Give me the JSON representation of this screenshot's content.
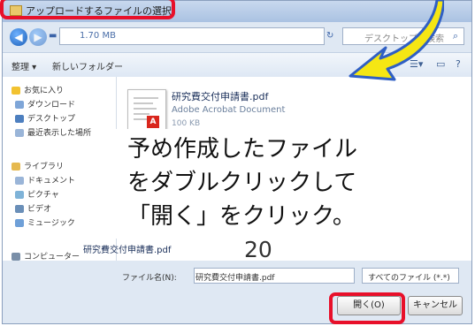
{
  "dialog": {
    "title": "アップロードするファイルの選択",
    "address": "1.70 MB",
    "search_placeholder": "デスクトップの検索"
  },
  "toolbar": {
    "organize": "整理 ▾",
    "new_folder": "新しいフォルダー"
  },
  "nav": {
    "items": [
      {
        "label": "お気に入り",
        "color": "#f2c230"
      },
      {
        "label": "ダウンロード",
        "color": "#7fa6d8"
      },
      {
        "label": "デスクトップ",
        "color": "#4d7fbf"
      },
      {
        "label": "最近表示した場所",
        "color": "#9ab5d8"
      },
      {
        "label": "ライブラリ",
        "color": "#e6b94f"
      },
      {
        "label": "ドキュメント",
        "color": "#9ab5d8"
      },
      {
        "label": "ピクチャ",
        "color": "#7fb3d8"
      },
      {
        "label": "ビデオ",
        "color": "#6a8fb8"
      },
      {
        "label": "ミュージック",
        "color": "#6fa0d8"
      },
      {
        "label": "コンピューター",
        "color": "#7a8fa8"
      }
    ]
  },
  "file": {
    "name": "研究費交付申請書.pdf",
    "type": "Adobe Acrobat Document",
    "size": "100 KB"
  },
  "selected_file_label": "研究費交付申請書.pdf",
  "bottom": {
    "filename_label": "ファイル名(N):",
    "filename_value": "研究費交付申請書.pdf",
    "filter": "すべてのファイル (*.*)",
    "open_button": "開く(O)",
    "cancel_button": "キャンセル"
  },
  "instruction": "予め作成したファイル をダブルクリックして「開く」をクリック。",
  "page_number": "20",
  "colors": {
    "highlight_red": "#e8102a",
    "arrow_yellow": "#f5e614"
  }
}
